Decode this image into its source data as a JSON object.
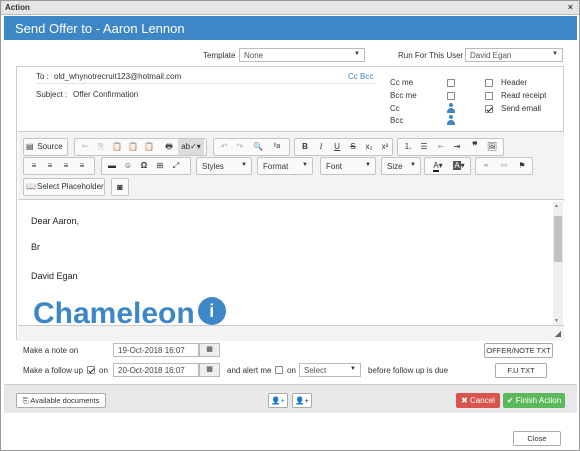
{
  "window": {
    "title": "Action",
    "close_glyph": "×"
  },
  "banner": {
    "title": "Send Offer to - Aaron Lennon"
  },
  "template": {
    "label": "Template",
    "value": "None"
  },
  "run_for": {
    "label": "Run For This User",
    "value": "David Egan"
  },
  "email": {
    "to_label": "To :",
    "to_value": "old_whynotrecruit123@hotmail.com",
    "cc_bcc_link": "Cc Bcc",
    "subject_label": "Subject :",
    "subject_value": "Offer Confirmation",
    "options": {
      "cc_me": "Cc me",
      "bcc_me": "Bcc me",
      "cc": "Cc",
      "bcc": "Bcc",
      "header": "Header",
      "read_receipt": "Read receipt",
      "send_email": "Send email"
    },
    "send_email_checked": true
  },
  "toolbar": {
    "source": "Source",
    "select_placeholder": "Select Placeholder",
    "dropdowns": {
      "styles": "Styles",
      "format": "Format",
      "font": "Font",
      "size": "Size"
    }
  },
  "body": {
    "greeting": "Dear Aaron,",
    "closing": "Br",
    "signature": "David Egan",
    "logo_text": "Chameleon"
  },
  "followup": {
    "note_label": "Make a note on",
    "note_date": "19-Oct-2018 16:07",
    "followup_label": "Make a follow up",
    "on_label": "on",
    "followup_date": "20-Oct-2018 16:07",
    "alert_label": "and alert me",
    "alert_on": "on",
    "select_value": "Select",
    "due_text": "before follow up is due",
    "offer_note_button": "OFFER/NOTE TXT",
    "fu_button": "F.U TXT"
  },
  "footer": {
    "available_docs": "Available documents",
    "cancel": "Cancel",
    "finish": "Finish Action",
    "close": "Close"
  },
  "colors": {
    "accent": "#3e87c6",
    "cancel": "#d9534f",
    "finish": "#5cb85c"
  }
}
